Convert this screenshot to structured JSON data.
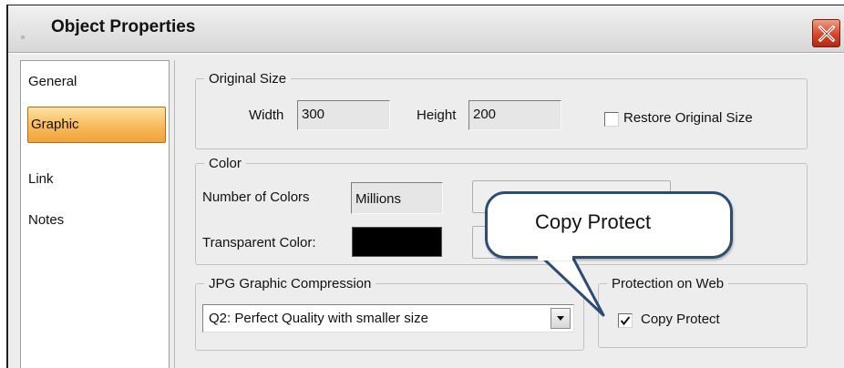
{
  "window": {
    "title": "Object Properties",
    "close_icon": "close-x-icon"
  },
  "sidebar": {
    "items": [
      {
        "label": "General",
        "selected": false
      },
      {
        "label": "Graphic",
        "selected": true
      },
      {
        "label": "Link",
        "selected": false
      },
      {
        "label": "Notes",
        "selected": false
      }
    ]
  },
  "original_size": {
    "legend": "Original Size",
    "width_label": "Width",
    "width_value": "300",
    "height_label": "Height",
    "height_value": "200",
    "restore_label": "Restore Original Size",
    "restore_checked": false
  },
  "color": {
    "legend": "Color",
    "number_label": "Number of Colors",
    "number_value": "Millions",
    "transparent_label": "Transparent Color:",
    "transparent_swatch": "#000000"
  },
  "jpg": {
    "legend": "JPG Graphic Compression",
    "selected": "Q2: Perfect Quality with smaller size"
  },
  "protection": {
    "legend": "Protection on Web",
    "copy_protect_label": "Copy Protect",
    "copy_protect_checked": true
  },
  "callout": {
    "text": "Copy Protect"
  }
}
